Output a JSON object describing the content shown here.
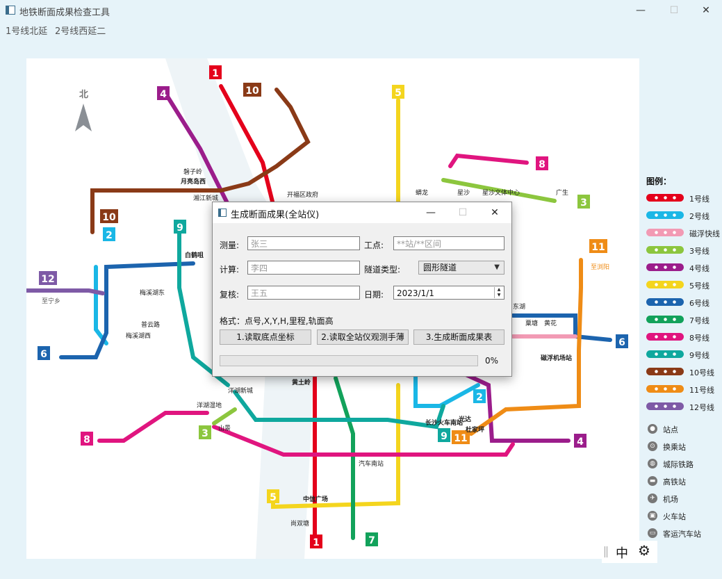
{
  "window": {
    "title": "地铁断面成果检查工具",
    "minimize": "—",
    "maximize": "☐",
    "close": "✕"
  },
  "menu": {
    "items": [
      "1号线北延",
      "2号线西延二"
    ]
  },
  "map": {
    "north_label": "北",
    "line_badges": [
      "1",
      "2",
      "3",
      "4",
      "5",
      "6",
      "7",
      "8",
      "9",
      "10",
      "11",
      "12"
    ],
    "station_labels": [
      "磐子岭",
      "月亮岛西",
      "开福区政府",
      "至宁乡",
      "至浏阳",
      "磁浮机场站",
      "长沙火车南站",
      "光达",
      "杜家坪",
      "中信广场",
      "尚双塘",
      "汽车南站",
      "洋湖新城",
      "洋湖湿地",
      "山景",
      "黄土岭",
      "白鹤咀",
      "梅溪湖东",
      "梅溪湖西",
      "普云路",
      "星沙",
      "星沙文体中心",
      "广生",
      "蟒龙",
      "东湖",
      "粟塘",
      "黄花",
      "湘江新城"
    ]
  },
  "legend": {
    "title": "图例：",
    "lines": [
      {
        "label": "1号线",
        "color": "#e4001b"
      },
      {
        "label": "2号线",
        "color": "#1ab7e6"
      },
      {
        "label": "磁浮快线",
        "color": "#f29ab4"
      },
      {
        "label": "3号线",
        "color": "#8cc63e"
      },
      {
        "label": "4号线",
        "color": "#9b1d8b"
      },
      {
        "label": "5号线",
        "color": "#f4d51e"
      },
      {
        "label": "6号线",
        "color": "#1c64ae"
      },
      {
        "label": "7号线",
        "color": "#12a25b"
      },
      {
        "label": "8号线",
        "color": "#e0157f"
      },
      {
        "label": "9号线",
        "color": "#0fa89e"
      },
      {
        "label": "10号线",
        "color": "#8a3a17"
      },
      {
        "label": "11号线",
        "color": "#ef8c16"
      },
      {
        "label": "12号线",
        "color": "#7e5aa6"
      }
    ],
    "symbols": [
      {
        "label": "站点",
        "icon": "station-icon"
      },
      {
        "label": "换乘站",
        "icon": "transfer-icon"
      },
      {
        "label": "城际铁路",
        "icon": "intercity-rail-icon"
      },
      {
        "label": "高铁站",
        "icon": "high-speed-rail-icon"
      },
      {
        "label": "机场",
        "icon": "airport-icon"
      },
      {
        "label": "火车站",
        "icon": "train-station-icon"
      },
      {
        "label": "客运汽车站",
        "icon": "bus-station-icon"
      }
    ]
  },
  "ime": {
    "mode": "中"
  },
  "dialog": {
    "title": "生成断面成果(全站仪)",
    "minimize": "—",
    "maximize": "☐",
    "close": "✕",
    "survey_label": "测量:",
    "survey_value": "张三",
    "workpoint_label": "工点:",
    "workpoint_placeholder": "**站/**区间",
    "calc_label": "计算:",
    "calc_value": "李四",
    "tunnel_type_label": "隧道类型:",
    "tunnel_type_value": "圆形隧道",
    "review_label": "复核:",
    "review_value": "王五",
    "date_label": "日期:",
    "date_value": "2023/1/1",
    "format_label": "格式：点号,X,Y,H,里程,轨面高",
    "btn_read_coords": "1.读取底点坐标",
    "btn_read_manual": "2.读取全站仪观测手薄",
    "btn_generate": "3.生成断面成果表",
    "progress": 0,
    "progress_text": "0%"
  }
}
